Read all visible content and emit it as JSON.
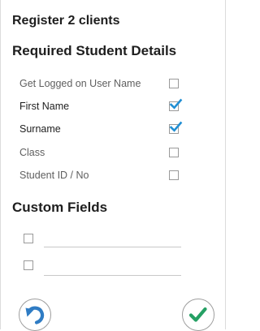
{
  "dialog": {
    "title": "Register 2 clients"
  },
  "required_section": {
    "heading": "Required Student Details",
    "fields": [
      {
        "label": "Get Logged on User Name",
        "checked": false,
        "emphasis": false
      },
      {
        "label": "First Name",
        "checked": true,
        "emphasis": true
      },
      {
        "label": "Surname",
        "checked": true,
        "emphasis": true
      },
      {
        "label": "Class",
        "checked": false,
        "emphasis": false
      },
      {
        "label": "Student ID / No",
        "checked": false,
        "emphasis": false
      }
    ]
  },
  "custom_section": {
    "heading": "Custom Fields",
    "fields": [
      {
        "checked": false,
        "value": ""
      },
      {
        "checked": false,
        "value": ""
      }
    ]
  },
  "actions": {
    "undo_icon": "undo-arrow-icon",
    "confirm_icon": "checkmark-icon"
  },
  "colors": {
    "check_accent": "#1f8ed3",
    "undo_accent": "#2f7cc4",
    "confirm_accent": "#25a064",
    "label_muted": "#5f5f5f",
    "label_strong": "#1e1e1e"
  }
}
